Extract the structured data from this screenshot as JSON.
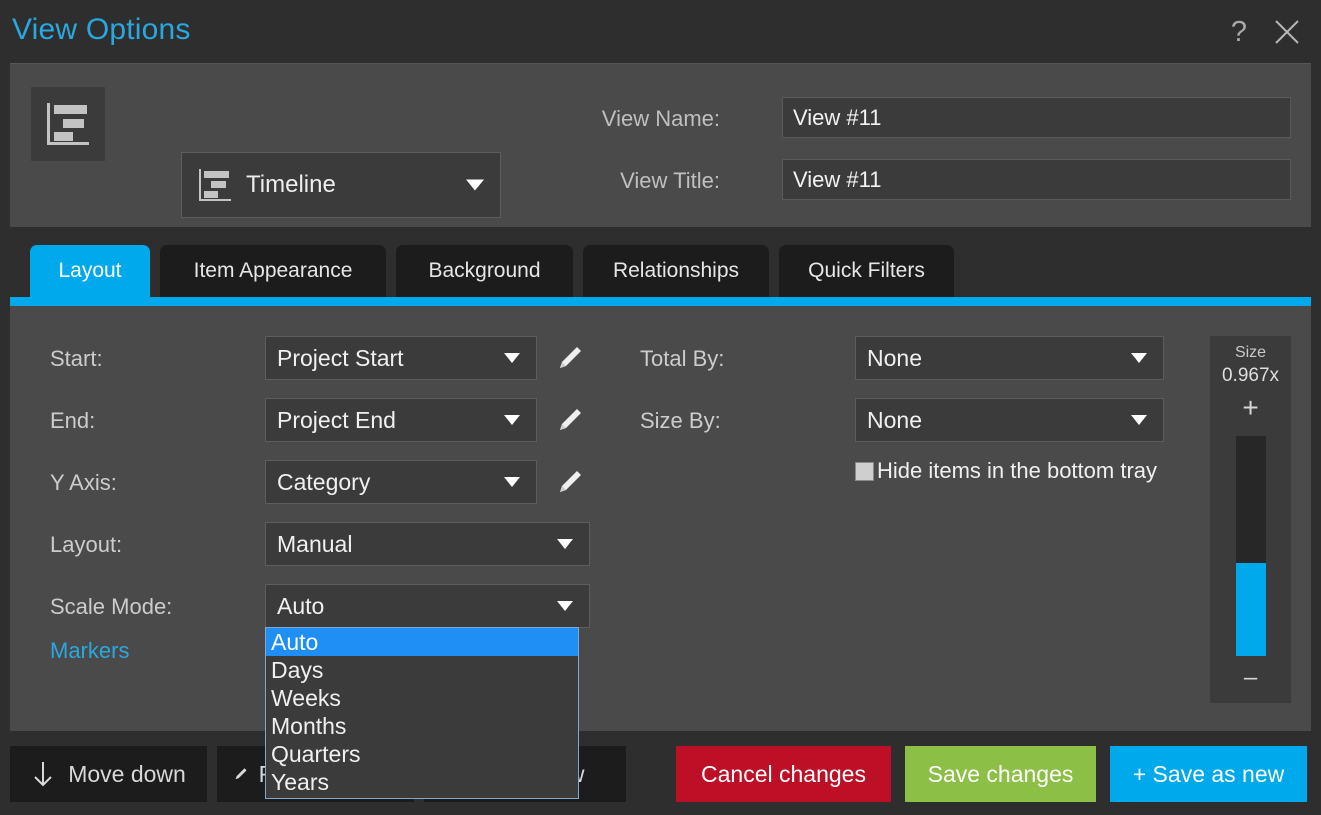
{
  "window": {
    "title": "View Options",
    "help_icon": "question-mark-icon",
    "close_icon": "close-icon",
    "accent_color": "#00a8ec",
    "title_color": "#29a8e0"
  },
  "header": {
    "view_type_icon": "timeline-gantt-icon",
    "view_type_select": {
      "value": "Timeline",
      "icon": "timeline-gantt-icon",
      "caret": "chevron-down-icon"
    },
    "view_name": {
      "label": "View Name:",
      "value": "View #11"
    },
    "view_title": {
      "label": "View Title:",
      "value": "View #11"
    }
  },
  "tabs": [
    {
      "label": "Layout",
      "active": true
    },
    {
      "label": "Item Appearance",
      "active": false
    },
    {
      "label": "Background",
      "active": false
    },
    {
      "label": "Relationships",
      "active": false
    },
    {
      "label": "Quick Filters",
      "active": false
    }
  ],
  "layout_tab": {
    "left_fields": [
      {
        "label": "Start:",
        "value": "Project Start",
        "edit": true
      },
      {
        "label": "End:",
        "value": "Project End",
        "edit": true
      },
      {
        "label": "Y Axis:",
        "value": "Category",
        "edit": true
      },
      {
        "label": "Layout:",
        "value": "Manual",
        "edit": false
      },
      {
        "label": "Scale Mode:",
        "value": "Auto",
        "edit": false
      }
    ],
    "markers_link": "Markers",
    "right_fields": [
      {
        "label": "Total By:",
        "value": "None"
      },
      {
        "label": "Size By:",
        "value": "None"
      }
    ],
    "hide_items_checkbox": {
      "label": "Hide items in the bottom tray",
      "checked": false
    },
    "scale_mode_dropdown": {
      "open": true,
      "selected": "Auto",
      "options": [
        "Auto",
        "Days",
        "Weeks",
        "Months",
        "Quarters",
        "Years"
      ]
    },
    "size_slider": {
      "title": "Size",
      "value": "0.967x",
      "increase_icon": "plus-icon",
      "decrease_icon": "minus-icon",
      "fill_color": "#00a8ec"
    }
  },
  "footer": {
    "move_down": {
      "label": "Move down",
      "icon": "arrow-down-icon"
    },
    "rename_view": {
      "label": "Rename view",
      "icon": "pencil-icon"
    },
    "delete_view": {
      "label": "Delete view"
    },
    "cancel": {
      "label": "Cancel changes",
      "color": "#bd0f26"
    },
    "save": {
      "label": "Save changes",
      "color": "#8cbf45"
    },
    "save_as_new": {
      "label": "+ Save as new",
      "color": "#00a8ec"
    }
  }
}
